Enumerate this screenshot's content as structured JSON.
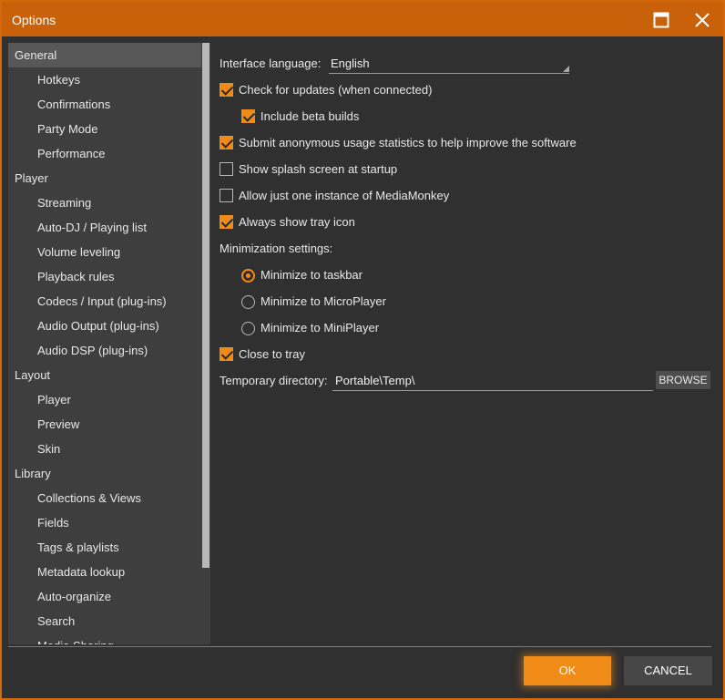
{
  "window": {
    "title": "Options"
  },
  "sidebar": {
    "items": [
      {
        "label": "General",
        "level": 0,
        "selected": true
      },
      {
        "label": "Hotkeys",
        "level": 1
      },
      {
        "label": "Confirmations",
        "level": 1
      },
      {
        "label": "Party Mode",
        "level": 1
      },
      {
        "label": "Performance",
        "level": 1
      },
      {
        "label": "Player",
        "level": 0
      },
      {
        "label": "Streaming",
        "level": 1
      },
      {
        "label": "Auto-DJ / Playing list",
        "level": 1
      },
      {
        "label": "Volume leveling",
        "level": 1
      },
      {
        "label": "Playback rules",
        "level": 1
      },
      {
        "label": "Codecs / Input (plug-ins)",
        "level": 1
      },
      {
        "label": "Audio Output (plug-ins)",
        "level": 1
      },
      {
        "label": "Audio DSP (plug-ins)",
        "level": 1
      },
      {
        "label": "Layout",
        "level": 0
      },
      {
        "label": "Player",
        "level": 1
      },
      {
        "label": "Preview",
        "level": 1
      },
      {
        "label": "Skin",
        "level": 1
      },
      {
        "label": "Library",
        "level": 0
      },
      {
        "label": "Collections & Views",
        "level": 1
      },
      {
        "label": "Fields",
        "level": 1
      },
      {
        "label": "Tags & playlists",
        "level": 1
      },
      {
        "label": "Metadata lookup",
        "level": 1
      },
      {
        "label": "Auto-organize",
        "level": 1
      },
      {
        "label": "Search",
        "level": 1
      },
      {
        "label": "Media Sharing",
        "level": 1
      }
    ]
  },
  "main": {
    "language_label": "Interface language:",
    "language_value": "English",
    "check_updates": {
      "label": "Check for updates (when connected)",
      "checked": true
    },
    "beta_builds": {
      "label": "Include beta builds",
      "checked": true
    },
    "usage_stats": {
      "label": "Submit anonymous usage statistics to help improve the software",
      "checked": true
    },
    "splash": {
      "label": "Show splash screen at startup",
      "checked": false
    },
    "one_instance": {
      "label": "Allow just one instance of MediaMonkey",
      "checked": false
    },
    "tray_icon": {
      "label": "Always show tray icon",
      "checked": true
    },
    "minimization_label": "Minimization settings:",
    "min_taskbar": {
      "label": "Minimize to taskbar",
      "selected": true
    },
    "min_microplayer": {
      "label": "Minimize to MicroPlayer",
      "selected": false
    },
    "min_miniplayer": {
      "label": "Minimize to MiniPlayer",
      "selected": false
    },
    "close_tray": {
      "label": "Close to tray",
      "checked": true
    },
    "temp_dir_label": "Temporary directory:",
    "temp_dir_value": "Portable\\Temp\\",
    "browse_label": "BROWSE"
  },
  "footer": {
    "ok_label": "OK",
    "cancel_label": "CANCEL"
  },
  "colors": {
    "accent": "#f08b17",
    "titlebar": "#c8610a",
    "background": "#303030",
    "sidebar": "#3e3e3e"
  }
}
